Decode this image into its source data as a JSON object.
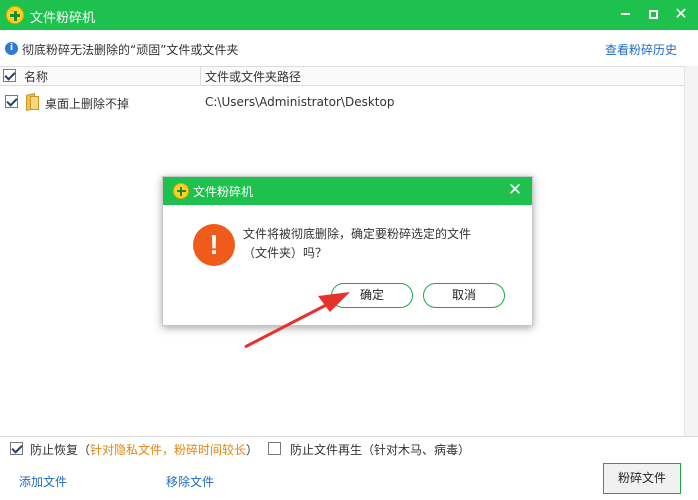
{
  "window": {
    "title": "文件粉碎机",
    "controls": {
      "minimize": "minimize",
      "maximize": "maximize",
      "close": "✕"
    }
  },
  "info_bar": {
    "icon": "info-icon",
    "text": "彻底粉碎无法删除的“顽固”文件或文件夹",
    "history_link": "查看粉碎历史"
  },
  "table": {
    "columns": [
      "名称",
      "文件或文件夹路径"
    ],
    "rows": [
      {
        "checked": true,
        "name": "桌面上删除不掉",
        "path": "C:\\Users\\Administrator\\Desktop"
      }
    ]
  },
  "options": {
    "prevent_recovery": {
      "checked": true,
      "label": "防止恢复（",
      "note": "针对隐私文件，粉碎时间较长",
      "close_paren": "）"
    },
    "prevent_regeneration": {
      "checked": false,
      "label": "防止文件再生（针对木马、病毒）"
    }
  },
  "footer": {
    "add_file": "添加文件",
    "remove_file": "移除文件",
    "shred_button": "粉碎文件"
  },
  "dialog": {
    "title": "文件粉碎机",
    "close": "✕",
    "warning_glyph": "!",
    "message_line1": "文件将被彻底删除，确定要粉碎选定的文件",
    "message_line2": "（文件夹）吗？",
    "ok_label": "确定",
    "cancel_label": "取消"
  },
  "colors": {
    "title_bar": "#1ec14e",
    "link": "#1e6bc4",
    "warning": "#f05a1a",
    "note_orange": "#e28512",
    "annotation_arrow": "#e8312a"
  }
}
